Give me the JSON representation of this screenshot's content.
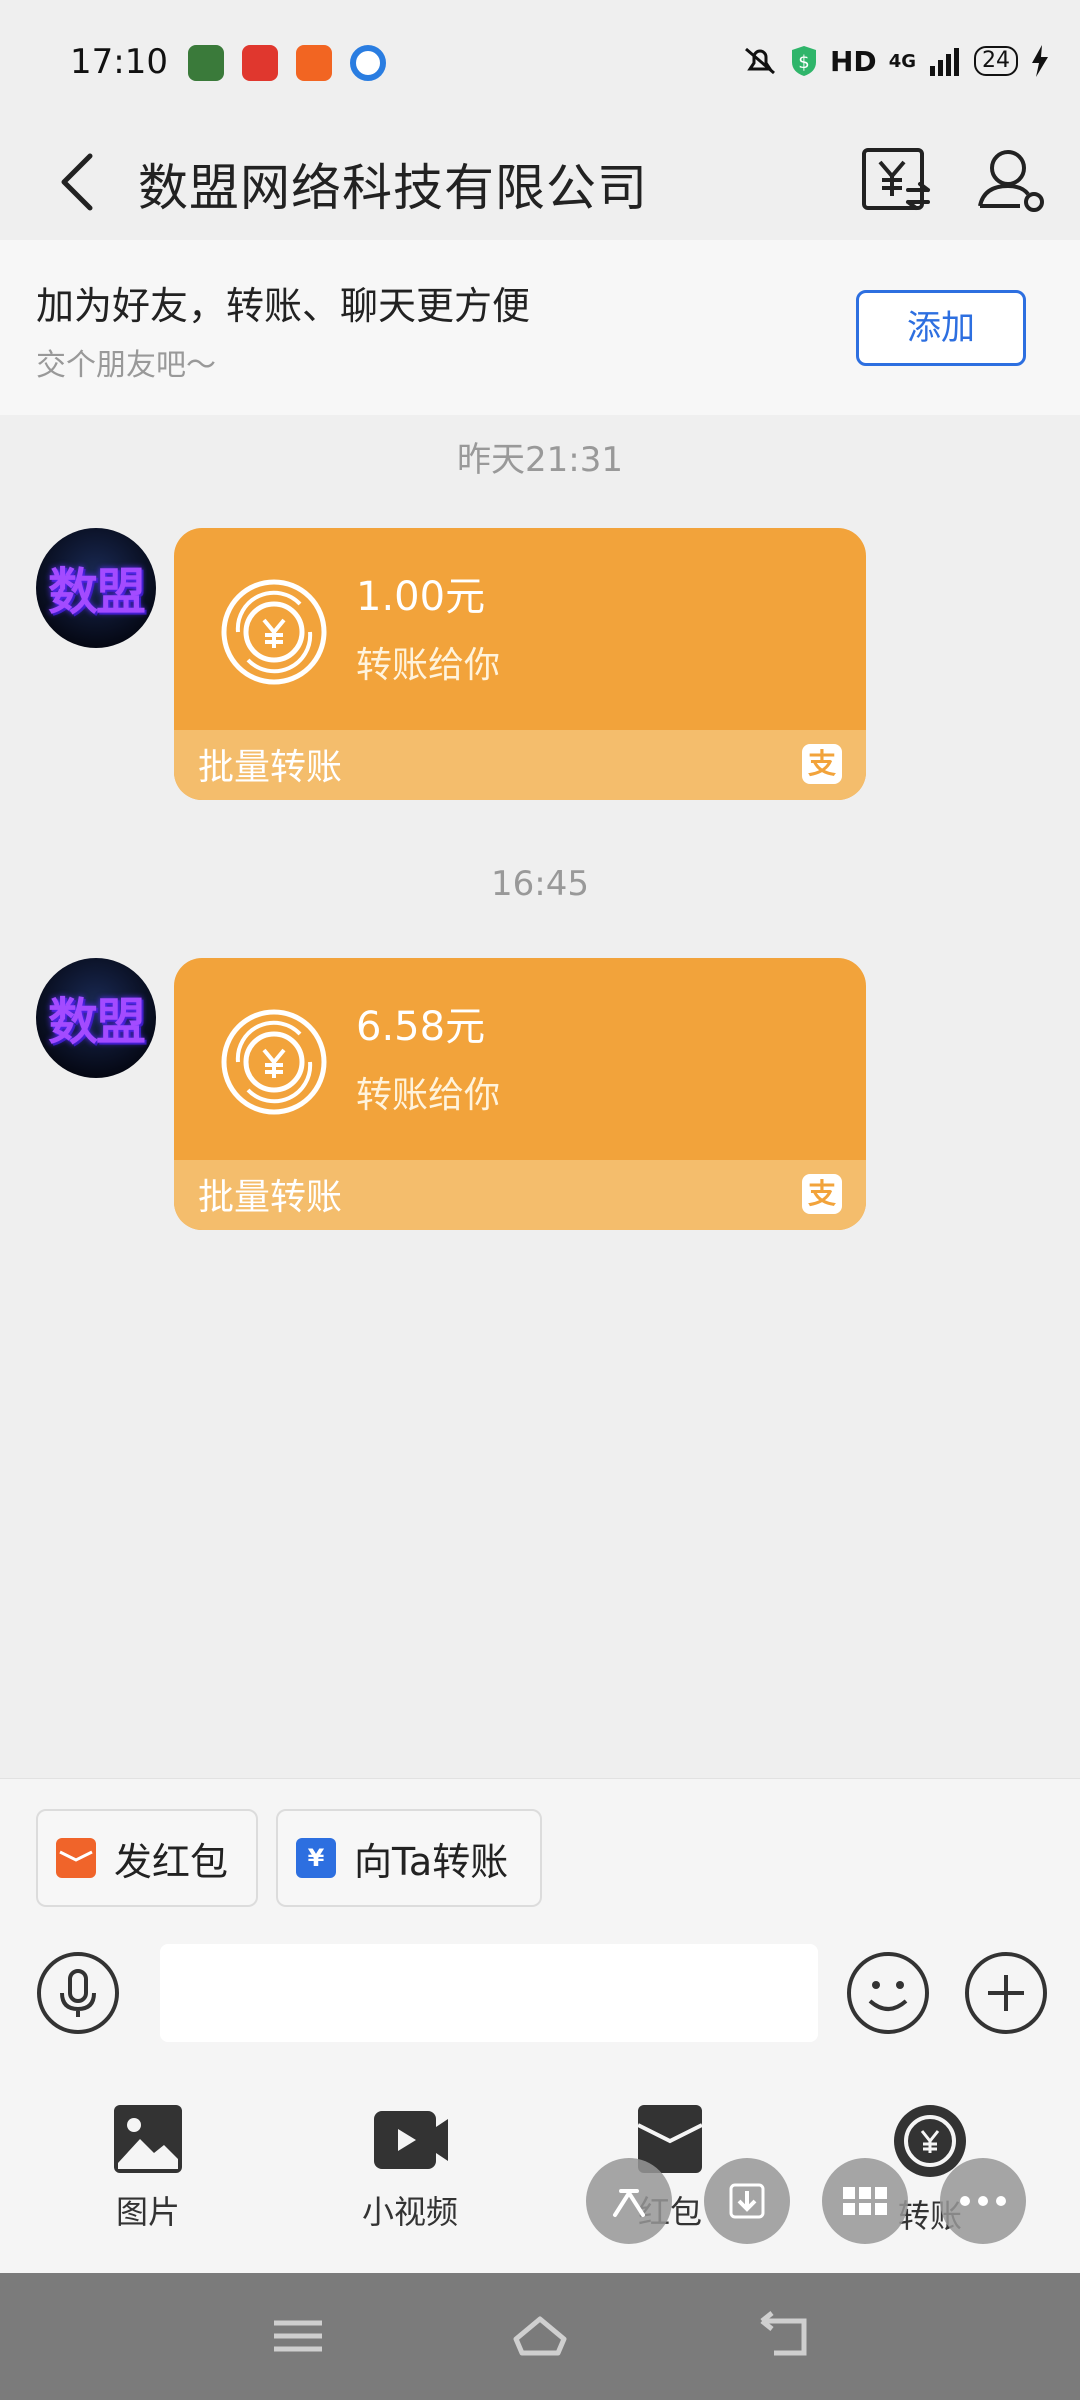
{
  "status_bar": {
    "time": "17:10",
    "network": "HD",
    "signal": "4G",
    "battery": "24"
  },
  "header": {
    "title": "数盟网络科技有限公司"
  },
  "friend_banner": {
    "title": "加为好友，转账、聊天更方便",
    "subtitle": "交个朋友吧～",
    "add_label": "添加"
  },
  "messages": [
    {
      "timestamp": "昨天21:31",
      "avatar_text": "数盟",
      "amount": "1.00元",
      "desc": "转账给你",
      "footer": "批量转账",
      "footer_icon": "支"
    },
    {
      "timestamp": "16:45",
      "avatar_text": "数盟",
      "amount": "6.58元",
      "desc": "转账给你",
      "footer": "批量转账",
      "footer_icon": "支"
    }
  ],
  "quick_actions": {
    "red_packet": "发红包",
    "transfer": "向Ta转账"
  },
  "toolbar": {
    "image": "图片",
    "video": "小视频",
    "red_packet": "红包",
    "transfer": "转账"
  },
  "colors": {
    "card": "#f2a33b",
    "card_footer": "#f4bd6c",
    "accent_blue": "#2d6fe0",
    "background": "#efefef"
  }
}
